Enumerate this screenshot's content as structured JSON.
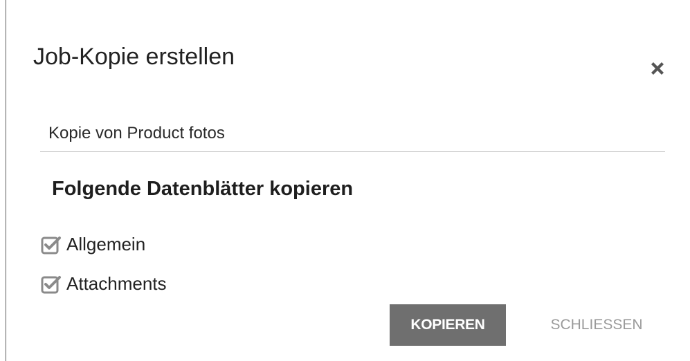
{
  "dialog": {
    "title": "Job-Kopie erstellen",
    "close_icon": "close-icon"
  },
  "name_field": {
    "value": "Kopie von Product fotos"
  },
  "datasheets": {
    "heading": "Folgende Datenblätter kopieren",
    "items": [
      {
        "label": "Allgemein",
        "checked": true,
        "icon": "checkbox-checked-icon"
      },
      {
        "label": "Attachments",
        "checked": true,
        "icon": "checkbox-checked-icon"
      }
    ]
  },
  "actions": {
    "copy_label": "KOPIEREN",
    "close_label": "SCHLIESSEN"
  },
  "colors": {
    "primary_button": "#6f6f6f",
    "secondary_text": "#9a9a9a",
    "checkbox": "#8a8a8a"
  }
}
